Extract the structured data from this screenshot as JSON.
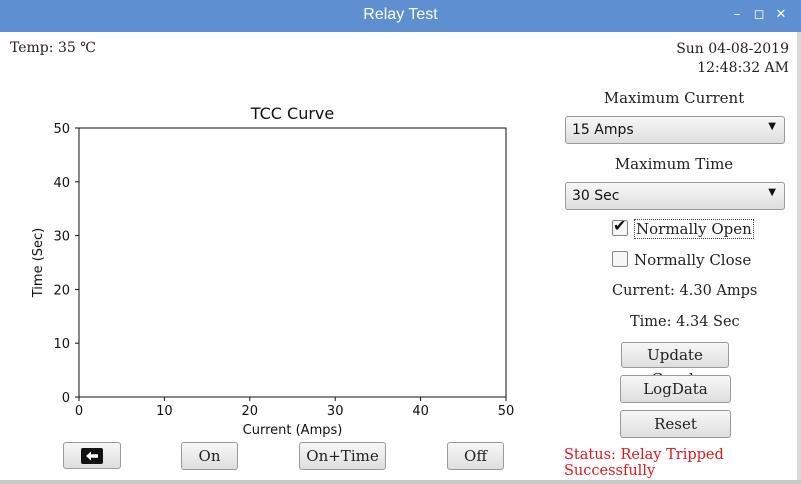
{
  "window": {
    "title": "Relay Test",
    "min_icon": "minimize-icon",
    "max_icon": "maximize-icon",
    "close_icon": "close-icon"
  },
  "header": {
    "temp": "Temp: 35 ℃",
    "date": "Sun 04-08-2019",
    "time": "12:48:32 AM"
  },
  "chart_data": {
    "type": "line",
    "title": "TCC Curve",
    "xlabel": "Current (Amps)",
    "ylabel": "Time (Sec)",
    "xlim": [
      0,
      50
    ],
    "ylim": [
      0,
      50
    ],
    "x_ticks": [
      "0",
      "10",
      "20",
      "30",
      "40",
      "50"
    ],
    "y_ticks": [
      "0",
      "10",
      "20",
      "30",
      "40",
      "50"
    ],
    "series": [],
    "grid": false
  },
  "controls": {
    "max_current_label": "Maximum Current",
    "max_current_value": "15 Amps",
    "max_time_label": "Maximum Time",
    "max_time_value": "30 Sec",
    "normally_open_label": "Normally Open",
    "normally_open_checked": true,
    "normally_close_label": "Normally Close",
    "normally_close_checked": false,
    "current_readout": "Current: 4.30 Amps",
    "time_readout": "Time: 4.34 Sec",
    "update_graph": "Update Graph",
    "log_data": "LogData",
    "reset": "Reset",
    "status": "Status: Relay Tripped Successfully"
  },
  "bottom_buttons": {
    "back_icon": "back-arrow-icon",
    "on": "On",
    "on_time": "On+Time",
    "off": "Off"
  }
}
